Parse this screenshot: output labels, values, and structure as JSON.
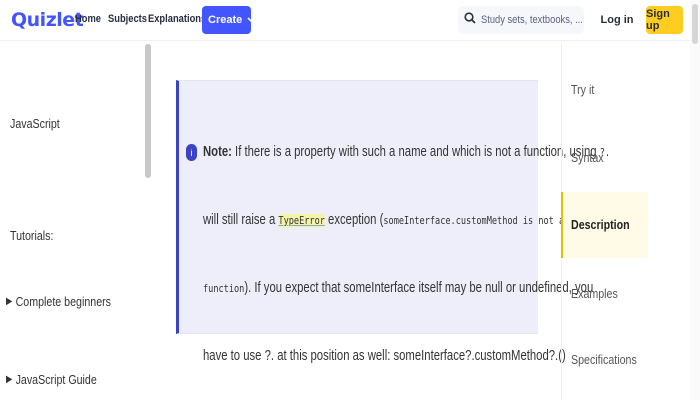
{
  "header": {
    "logo": "Quizlet",
    "nav": [
      "Home",
      "Subjects",
      "Explanations"
    ],
    "create_label": "Create",
    "search_placeholder": "Study sets, textbooks, ...",
    "login_label": "Log in",
    "signup_label": "Sign up"
  },
  "sidebar": {
    "title": "JavaScript",
    "heading": "Tutorials:",
    "items": [
      {
        "label": "Complete beginners"
      },
      {
        "label": "JavaScript Guide"
      }
    ]
  },
  "note": {
    "icon": "i",
    "label": "Note:",
    "line1_text": " If there is a property with such a name and which is not a function, using ",
    "line1_op": "?.",
    "line2_pre": "will still raise a ",
    "line2_link": "TypeError",
    "line2_mid": " exception (",
    "line2_code": "someInterface.customMethod is not a",
    "line3_code": "function",
    "line3_text": "). If you expect that someInterface itself may be null or undefined, you",
    "line4_text": "have to use ?. at this position as well: someInterface?.customMethod?.()"
  },
  "toc": {
    "items": [
      "Try it",
      "Syntax",
      "Description",
      "Examples",
      "Specifications"
    ],
    "active": "Description"
  },
  "colors": {
    "brand": "#4255ff",
    "signup": "#ffcd1f",
    "note_bg": "#eeeefb",
    "note_accent": "#3b42c4"
  },
  "icons": {
    "search": "search-icon",
    "create_chevron": "chevron-down-icon",
    "note": "info-icon",
    "sidebar_arrow": "triangle-right-icon"
  }
}
